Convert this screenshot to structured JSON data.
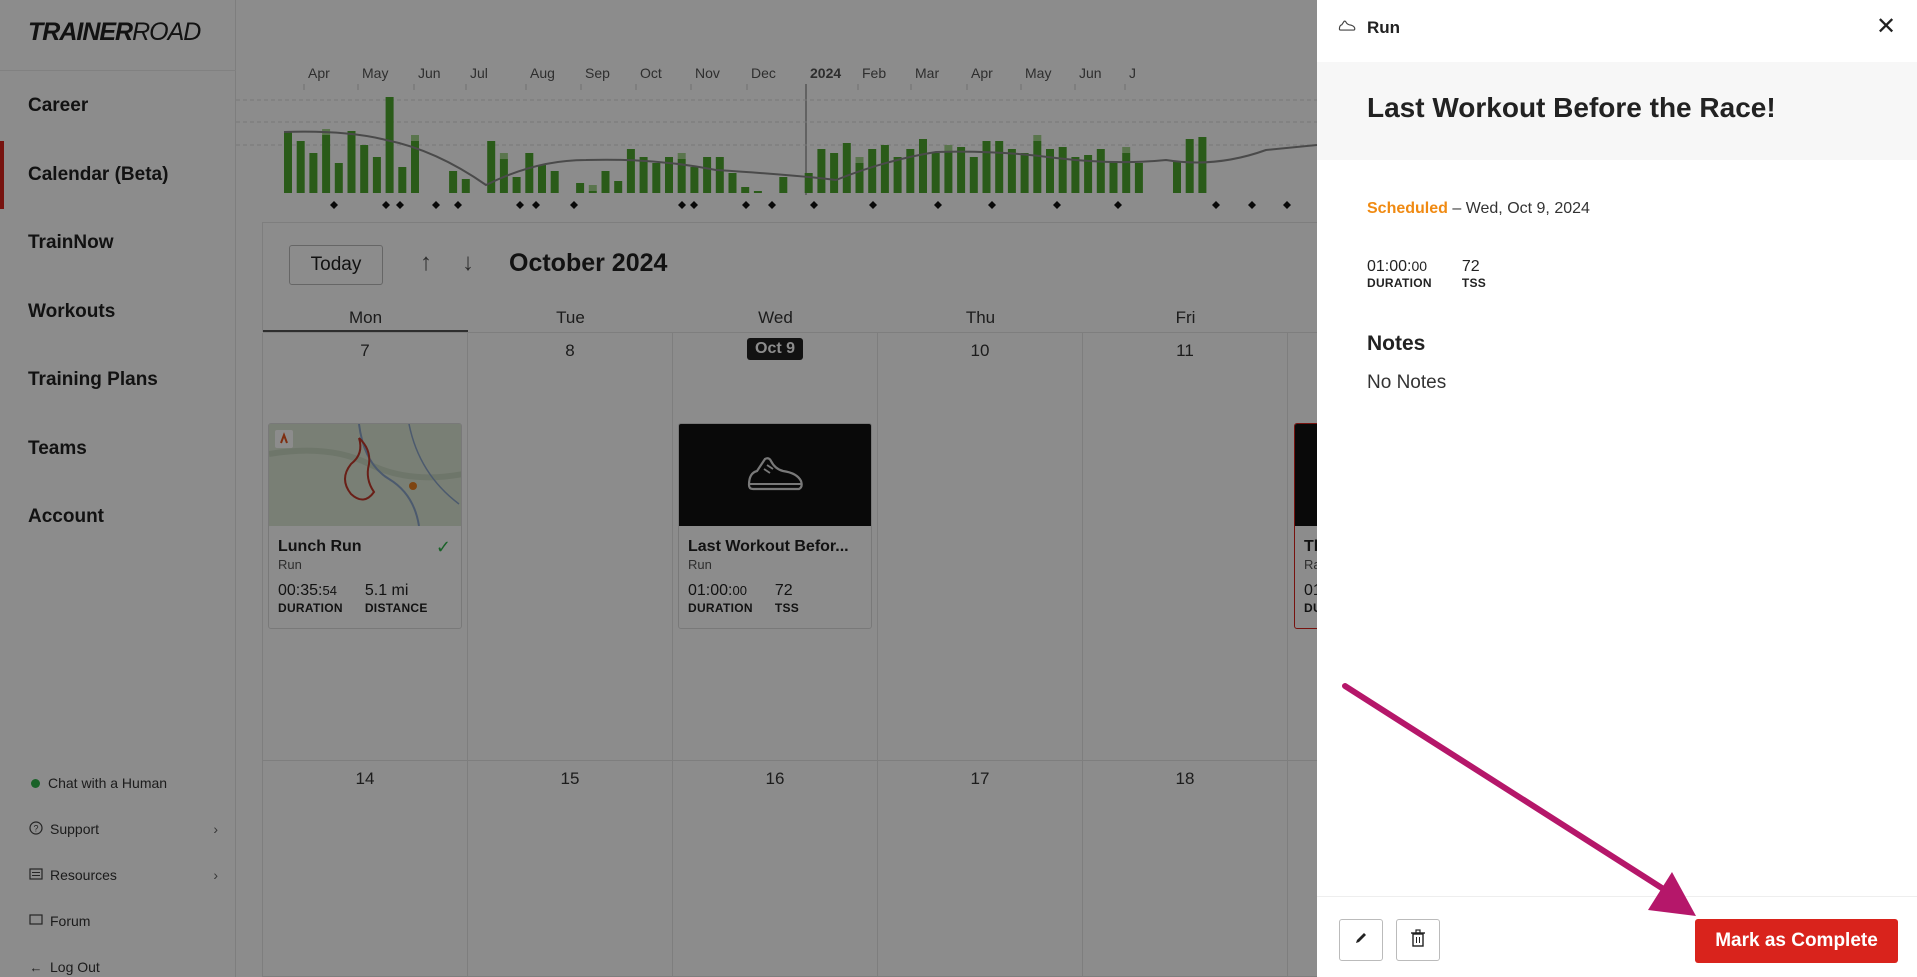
{
  "sidebar": {
    "logo_bold": "TRAINER",
    "logo_thin": "ROAD",
    "items": [
      {
        "label": "Career"
      },
      {
        "label": "Calendar (Beta)"
      },
      {
        "label": "TrainNow"
      },
      {
        "label": "Workouts"
      },
      {
        "label": "Training Plans"
      },
      {
        "label": "Teams"
      },
      {
        "label": "Account"
      }
    ],
    "bottom": {
      "chat": "Chat with a Human",
      "support": "Support",
      "resources": "Resources",
      "forum": "Forum",
      "logout": "Log Out"
    }
  },
  "chart": {
    "months": [
      "Apr",
      "May",
      "Jun",
      "Jul",
      "Aug",
      "Sep",
      "Oct",
      "Nov",
      "Dec",
      "2024",
      "Feb",
      "Mar",
      "Apr",
      "May",
      "Jun",
      "J"
    ],
    "colors": {
      "bar": "#4ea62e",
      "bar_light": "#a5d68c",
      "line": "#888888"
    }
  },
  "calendar": {
    "today_label": "Today",
    "month_title": "October 2024",
    "days_of_week": [
      "Mon",
      "Tue",
      "Wed",
      "Thu",
      "Fri"
    ],
    "week1": [
      "7",
      "8",
      "Oct 9",
      "10",
      "11"
    ],
    "week2": [
      "14",
      "15",
      "16",
      "17",
      "18"
    ],
    "cards": {
      "lunch": {
        "title": "Lunch Run",
        "sub": "Run",
        "d_main": "00:35:",
        "d_small": "54",
        "d_label": "DURATION",
        "m2": "5.1 mi",
        "m2_label": "DISTANCE"
      },
      "last": {
        "title": "Last Workout Befor...",
        "sub": "Run",
        "d_main": "01:00:",
        "d_small": "00",
        "d_label": "DURATION",
        "m2": "72",
        "m2_label": "TSS"
      },
      "partial": {
        "title": "Th",
        "sub": "Ra",
        "d_main": "01",
        "d_label": "DU"
      }
    }
  },
  "panel": {
    "type": "Run",
    "title": "Last Workout Before the Race!",
    "status": "Scheduled",
    "date": " – Wed, Oct 9, 2024",
    "duration_main": "01:00:",
    "duration_small": "00",
    "duration_label": "DURATION",
    "tss": "72",
    "tss_label": "TSS",
    "notes_heading": "Notes",
    "notes_text": "No Notes",
    "complete_label": "Mark as Complete"
  },
  "colors": {
    "accent": "#d9231c",
    "scheduled": "#f08a12",
    "annotation": "#b5176a"
  }
}
